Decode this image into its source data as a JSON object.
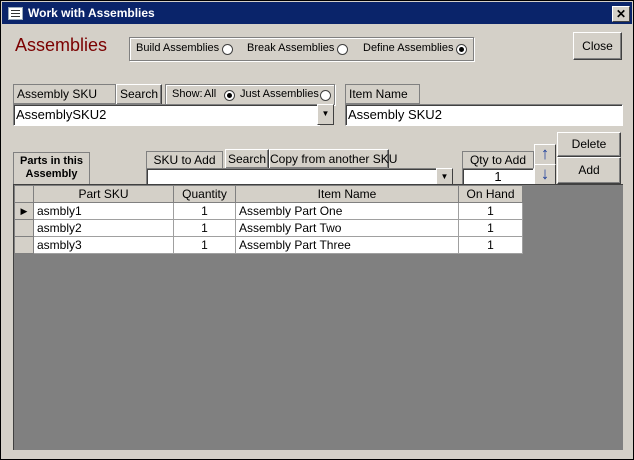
{
  "window": {
    "title": "Work with Assemblies",
    "close_glyph": "✕"
  },
  "header": {
    "title": "Assemblies"
  },
  "mode_options": [
    {
      "label": "Build Assemblies",
      "selected": false
    },
    {
      "label": "Break Assemblies",
      "selected": false
    },
    {
      "label": "Define Assemblies",
      "selected": true
    }
  ],
  "buttons": {
    "close": "Close",
    "search1": "Search",
    "search2": "Search",
    "copy_sku": "Copy from another SKU",
    "delete": "Delete",
    "add": "Add"
  },
  "assembly_sku": {
    "label": "Assembly SKU",
    "value": "AssemblySKU2"
  },
  "show_filter": {
    "label": "Show:",
    "options": [
      {
        "label": "All",
        "selected": true
      },
      {
        "label": "Just Assemblies",
        "selected": false
      }
    ]
  },
  "item_name": {
    "label": "Item Name",
    "value": "Assembly SKU2"
  },
  "parts_label": "Parts in this Assembly",
  "sku_to_add": {
    "label": "SKU to Add",
    "value": ""
  },
  "qty_to_add": {
    "label": "Qty to Add",
    "value": "1"
  },
  "parts_table": {
    "columns": [
      "Part SKU",
      "Quantity",
      "Item Name",
      "On Hand"
    ],
    "rows": [
      {
        "sku": "asmbly1",
        "qty": "1",
        "name": "Assembly Part One",
        "onhand": "1"
      },
      {
        "sku": "asmbly2",
        "qty": "1",
        "name": "Assembly Part Two",
        "onhand": "1"
      },
      {
        "sku": "asmbly3",
        "qty": "1",
        "name": "Assembly Part Three",
        "onhand": "1"
      }
    ]
  },
  "icons": {
    "window": "form-icon",
    "move_up": "arrow-up-icon",
    "move_down": "arrow-down-icon",
    "record_selector": "record-pointer-icon"
  }
}
